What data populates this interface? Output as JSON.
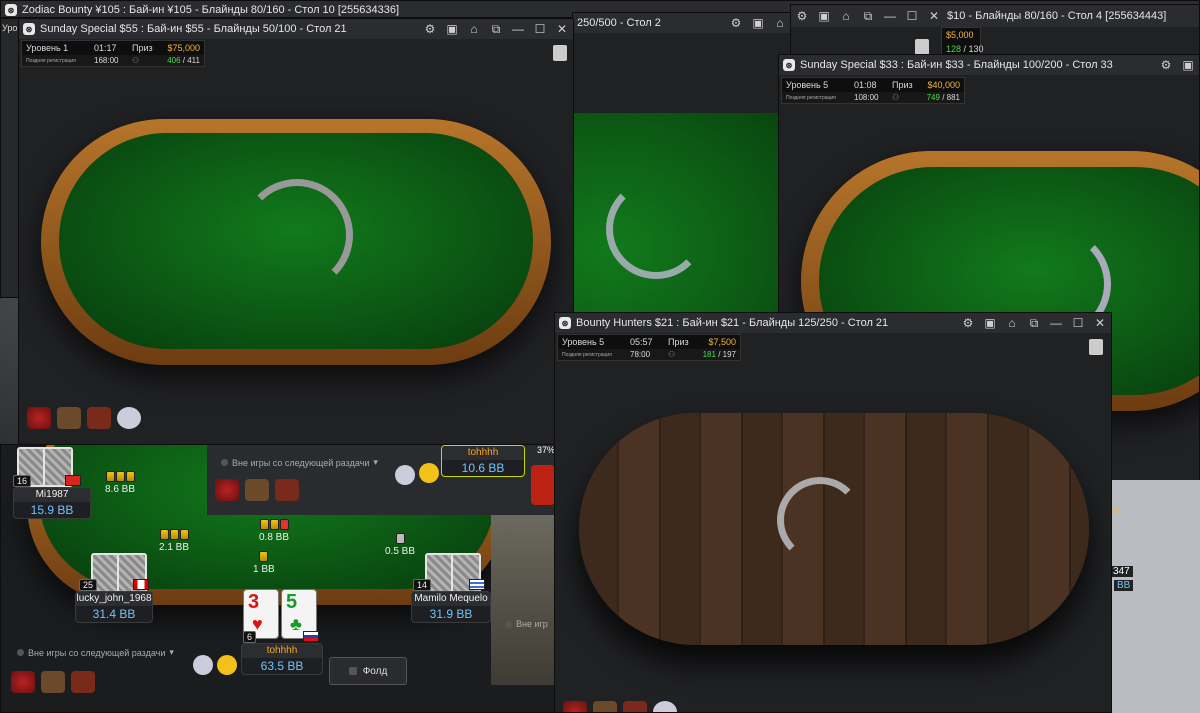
{
  "windows": {
    "zodiac": {
      "title": "Zodiac Bounty ¥105 : Бай-ин ¥105 - Блайнды 80/160 - Стол 10 [255634336]",
      "level_stub": "Уров"
    },
    "sunday55": {
      "title": "Sunday Special $55 : Бай-ин $55 - Блайнды 50/100 - Стол 21",
      "level": "Уровень 1",
      "time": "01:17",
      "prize_label": "Приз",
      "prize": "$75,000",
      "reg_label": "Поздняя регистрация",
      "late": "168:00",
      "players_in": "406",
      "players_total": "411"
    },
    "table2": {
      "title": "250/500 - Стол 2"
    },
    "zodiac4": {
      "title": "$10 - Блайнды 80/160 - Стол 4 [255634443]",
      "prize": "$5,000",
      "players_in": "128",
      "players_total": "130"
    },
    "sunday33": {
      "title": "Sunday Special $33 : Бай-ин $33 - Блайнды 100/200 - Стол 33",
      "level": "Уровень 5",
      "time": "01:08",
      "prize_label": "Приз",
      "prize": "$40,000",
      "reg_label": "Поздняя регистрация",
      "late": "108:00",
      "players_in": "749",
      "players_total": "881"
    },
    "bounty21": {
      "title": "Bounty Hunters $21 : Бай-ин $21 - Блайнды 125/250 - Стол 21",
      "level": "Уровень 5",
      "time": "05:57",
      "prize_label": "Приз",
      "prize": "$7,500",
      "reg_label": "Поздняя регистрация",
      "late": "78:00",
      "players_in": "181",
      "players_total": "197"
    }
  },
  "bottom_table": {
    "players": {
      "mi1987": {
        "name": "Mi1987",
        "stack": "15.9 BB",
        "seat": "16"
      },
      "lucky": {
        "name": "lucky_john_1968",
        "stack": "31.4 BB",
        "seat": "25"
      },
      "mamilo": {
        "name": "Mamilo Mequelo",
        "stack": "31.9 BB",
        "seat": "14"
      },
      "hero": {
        "name": "tohhhh",
        "stack": "63.5 BB",
        "seat": "6"
      },
      "hero_top": {
        "name": "tohhhh",
        "stack": "10.6 BB"
      }
    },
    "bets": {
      "b1": "8.6 BB",
      "b2": "2.1 BB",
      "b3": "0.8 BB",
      "b4": "1 BB",
      "b5": "0.5 BB"
    },
    "hero_cards": [
      {
        "rank": "3",
        "suit": "♥",
        "color": "#d11"
      },
      {
        "rank": "5",
        "suit": "♣",
        "color": "#179a2a"
      }
    ],
    "sitout_label": "Вне игры со следующей раздачи",
    "sitout_short": "Вне игр",
    "fold_label": "Фолд",
    "equity": "37%"
  },
  "right_peek": {
    "stack_stub": "75",
    "name_stub": "347",
    "bb_stub": "BB"
  },
  "icons": {
    "gear": "gear-icon",
    "lobby": "lobby-icon",
    "home": "home-icon",
    "tile": "tile-icon",
    "minimize": "minimize-icon",
    "maximize": "maximize-icon",
    "close": "close-icon"
  }
}
